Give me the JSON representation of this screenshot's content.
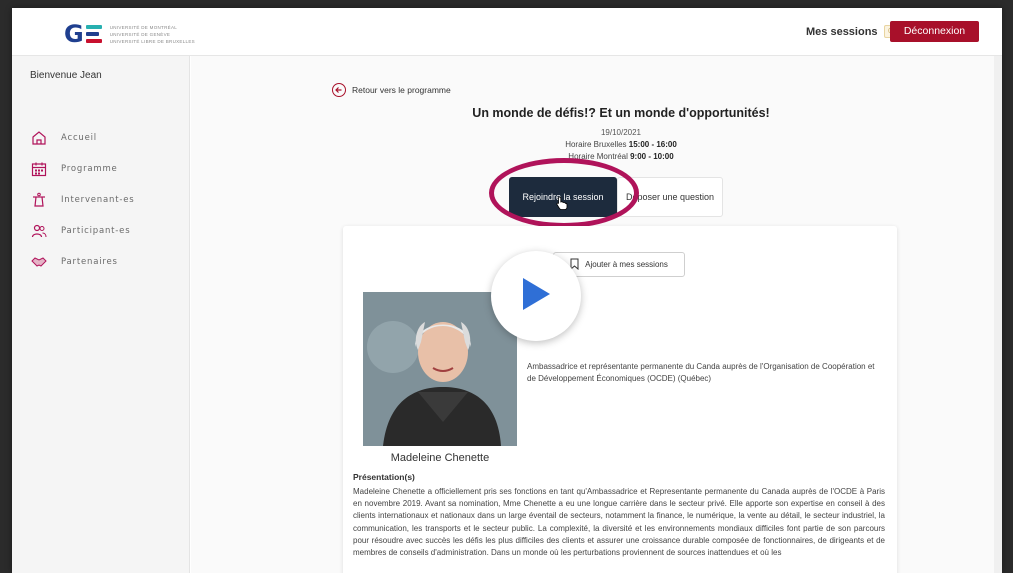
{
  "header": {
    "logo_letters": "GE",
    "logo_lines": [
      "UNIVERSITÉ DE MONTRÉAL",
      "UNIVERSITÉ DE GENÈVE",
      "UNIVERSITÉ LIBRE DE BRUXELLES"
    ],
    "my_sessions_label": "Mes sessions",
    "my_sessions_count": "0",
    "logout_label": "Déconnexion",
    "accent_color": "#a8102a"
  },
  "sidebar": {
    "welcome": "Bienvenue Jean",
    "items": [
      {
        "label": "Accueil",
        "icon": "home-icon"
      },
      {
        "label": "Programme",
        "icon": "calendar-icon"
      },
      {
        "label": "Intervenant-es",
        "icon": "podium-icon"
      },
      {
        "label": "Participant-es",
        "icon": "users-icon"
      },
      {
        "label": "Partenaires",
        "icon": "handshake-icon"
      }
    ]
  },
  "main": {
    "back_label": "Retour vers le programme",
    "title": "Un monde de défis!? Et un monde d'opportunités!",
    "date": "19/10/2021",
    "time_brussels_label": "Horaire Bruxelles",
    "time_brussels_value": "15:00 - 16:00",
    "time_montreal_label": "Horaire Montréal",
    "time_montreal_value": "9:00 - 10:00",
    "join_label": "Rejoindre la session",
    "ask_label": "Déposer une question",
    "add_label": "Ajouter à mes sessions"
  },
  "speaker": {
    "name": "Madeleine Chenette",
    "role": "Ambassadrice et représentante permanente du Canda auprès de l'Organisation de Coopération et de Développement Économiques (OCDE) (Québec)"
  },
  "presentation": {
    "title": "Présentation(s)",
    "text": "Madeleine Chenette a officiellement pris ses fonctions en tant qu'Ambassadrice et Representante permanente du Canada auprès de l'OCDE à Paris en novembre 2019. Avant sa nomination, Mme Chenette a eu une longue carrière dans le secteur privé. Elle apporte son expertise en conseil à des clients internationaux et nationaux dans un large éventail de secteurs, notamment la finance, le numérique, la vente au détail, le secteur industriel, la communication, les transports et le secteur public. La complexité, la diversité et les environnements mondiaux difficiles font partie de son parcours pour résoudre avec succès les défis les plus difficiles des clients et assurer une croissance durable composée de fonctionnaires, de dirigeants et de membres de conseils d'administration. Dans un monde où les perturbations proviennent de sources inattendues et où les"
  }
}
